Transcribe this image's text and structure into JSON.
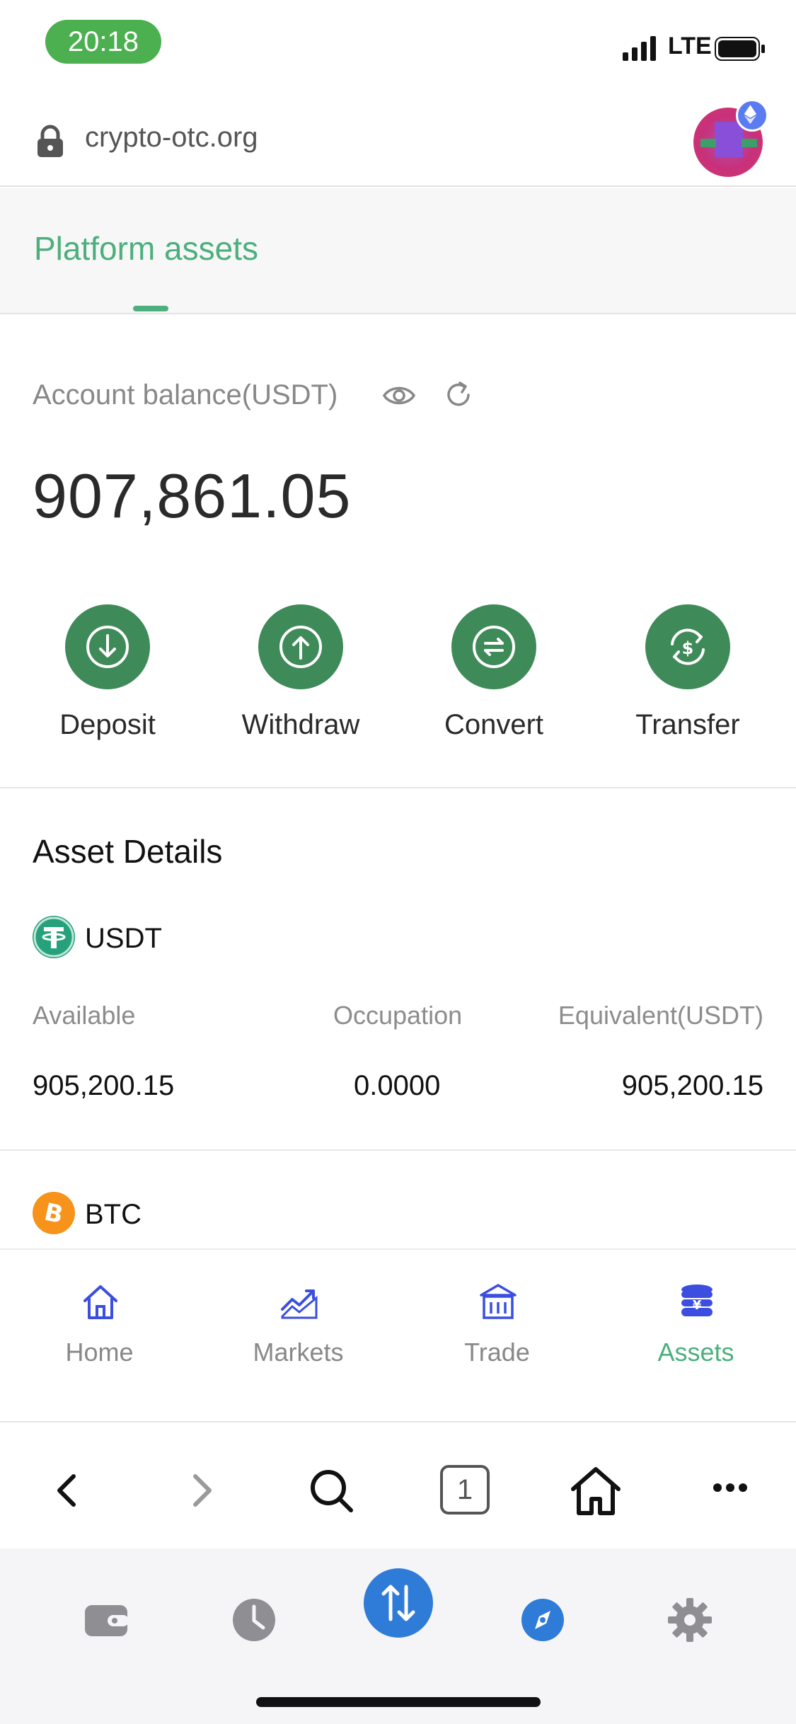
{
  "status_bar": {
    "time": "20:18",
    "network": "LTE"
  },
  "browser": {
    "url": "crypto-otc.org",
    "tab_count": "1"
  },
  "tabs": {
    "active_label": "Platform assets"
  },
  "balance": {
    "label": "Account balance(USDT)",
    "value": "907,861.05"
  },
  "actions": [
    {
      "label": "Deposit",
      "icon": "download-icon"
    },
    {
      "label": "Withdraw",
      "icon": "upload-icon"
    },
    {
      "label": "Convert",
      "icon": "convert-icon"
    },
    {
      "label": "Transfer",
      "icon": "transfer-icon"
    }
  ],
  "asset_details": {
    "title": "Asset Details",
    "columns": {
      "available": "Available",
      "occupation": "Occupation",
      "equivalent": "Equivalent(USDT)"
    },
    "assets": [
      {
        "symbol": "USDT",
        "available": "905,200.15",
        "occupation": "0.0000",
        "equivalent": "905,200.15",
        "color": "#26a17b"
      },
      {
        "symbol": "BTC",
        "color": "#f7931a"
      }
    ]
  },
  "nav": [
    {
      "label": "Home",
      "icon": "home-icon"
    },
    {
      "label": "Markets",
      "icon": "chart-icon"
    },
    {
      "label": "Trade",
      "icon": "bank-icon"
    },
    {
      "label": "Assets",
      "icon": "coins-icon",
      "active": true
    }
  ],
  "colors": {
    "accent": "#4caf7d",
    "action_green": "#3f8a59",
    "nav_icon_blue": "#3b4ee0",
    "dock_blue": "#2f7bd8"
  }
}
